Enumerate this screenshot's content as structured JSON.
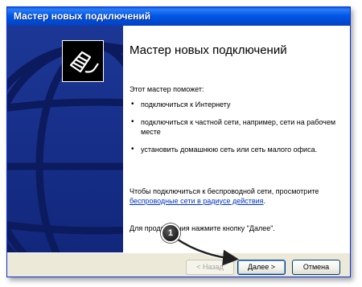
{
  "window": {
    "title": "Мастер новых подключений"
  },
  "content": {
    "heading": "Мастер новых подключений",
    "intro": "Этот мастер поможет:",
    "bullets": [
      "подключиться к Интернету",
      "подключиться к частной сети, например, сети на рабочем месте",
      "установить домашнюю сеть или сеть малого офиса."
    ],
    "wireless_text": "Чтобы подключиться к беспроводной сети, просмотрите",
    "wireless_link": "беспроводные сети в радиусе действия",
    "wireless_suffix": ".",
    "footer": "Для продолжения нажмите кнопку \"Далее\"."
  },
  "buttons": {
    "back": "< Назад",
    "next": "Далее >",
    "cancel": "Отмена"
  },
  "annotation": {
    "step": "1"
  },
  "icons": {
    "wizard_icon": "network-cable-icon",
    "background": "globe-graphic"
  },
  "colors": {
    "titlebar": "#0058e6",
    "left_panel": "#1c3796",
    "link": "#0033cc"
  }
}
